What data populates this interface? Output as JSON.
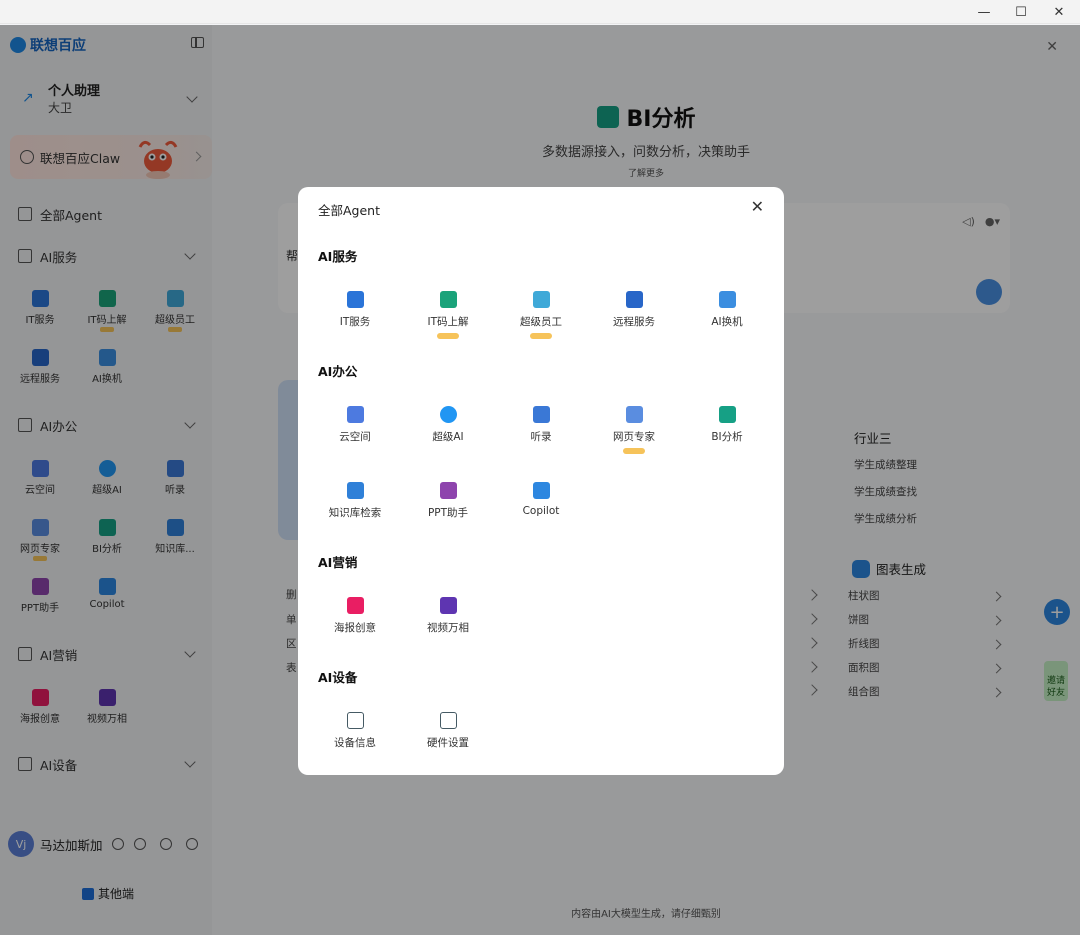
{
  "window": {
    "minimize": "—",
    "maximize": "☐",
    "close": "✕"
  },
  "sidebar": {
    "brand": "联想百应",
    "assistant": {
      "title": "个人助理",
      "subtitle": "大卫"
    },
    "claw": "联想百应Claw",
    "all_agent": "全部Agent",
    "ai_service": {
      "label": "AI服务",
      "items": [
        {
          "label": "IT服务",
          "color": "#2a74d8"
        },
        {
          "label": "IT码上解",
          "color": "#1aa37a"
        },
        {
          "label": "超级员工",
          "color": "#3fa9d8"
        },
        {
          "label": "远程服务",
          "color": "#2866c8"
        },
        {
          "label": "AI换机",
          "color": "#3b8ee0"
        }
      ]
    },
    "ai_office": {
      "label": "AI办公",
      "items": [
        {
          "label": "云空间",
          "color": "#4d7ae0"
        },
        {
          "label": "超级AI",
          "color": "#2196f3"
        },
        {
          "label": "听录",
          "color": "#3a78d6"
        },
        {
          "label": "网页专家",
          "color": "#5a8de0"
        },
        {
          "label": "BI分析",
          "color": "#16a085"
        },
        {
          "label": "知识库...",
          "color": "#2f80d8"
        },
        {
          "label": "PPT助手",
          "color": "#8e44ad"
        },
        {
          "label": "Copilot",
          "color": "#2d87e0"
        }
      ]
    },
    "ai_marketing": {
      "label": "AI营销",
      "items": [
        {
          "label": "海报创意",
          "color": "#e91e63"
        },
        {
          "label": "视频万相",
          "color": "#5e35b1"
        }
      ]
    },
    "ai_device": {
      "label": "AI设备"
    },
    "user": {
      "avatar": "Vj",
      "name": "马达加斯加"
    },
    "other_end": "其他端"
  },
  "main": {
    "title": "BI分析",
    "subtitle": "多数据源接入，问数分析，决策助手",
    "learn_more": "了解更多",
    "help_prefix": "帮",
    "industry3": {
      "title": "行业三",
      "items": [
        "学生成绩整理",
        "学生成绩查找",
        "学生成绩分析"
      ]
    },
    "chart_gen": {
      "title": "图表生成",
      "items": [
        "柱状图",
        "饼图",
        "折线图",
        "面积图",
        "组合图"
      ]
    },
    "left_list": [
      "删",
      "单",
      "区",
      "表"
    ],
    "invite": "邀请好友",
    "footer": "内容由AI大模型生成，请仔细甄别"
  },
  "modal": {
    "title": "全部Agent",
    "groups": [
      {
        "title": "AI服务",
        "items": [
          {
            "label": "IT服务",
            "color": "#2a74d8",
            "beta": false
          },
          {
            "label": "IT码上解",
            "color": "#1aa37a",
            "beta": true
          },
          {
            "label": "超级员工",
            "color": "#3fa9d8",
            "beta": true
          },
          {
            "label": "远程服务",
            "color": "#2866c8",
            "beta": false
          },
          {
            "label": "AI换机",
            "color": "#3b8ee0",
            "beta": false
          }
        ]
      },
      {
        "title": "AI办公",
        "items": [
          {
            "label": "云空间",
            "color": "#4d7ae0",
            "beta": false
          },
          {
            "label": "超级AI",
            "color": "#2196f3",
            "beta": false
          },
          {
            "label": "听录",
            "color": "#3a78d6",
            "beta": false
          },
          {
            "label": "网页专家",
            "color": "#5a8de0",
            "beta": true
          },
          {
            "label": "BI分析",
            "color": "#16a085",
            "beta": false
          },
          {
            "label": "知识库检索",
            "color": "#2f80d8",
            "beta": false
          },
          {
            "label": "PPT助手",
            "color": "#8e44ad",
            "beta": false
          },
          {
            "label": "Copilot",
            "color": "#2d87e0",
            "beta": false
          }
        ]
      },
      {
        "title": "AI营销",
        "items": [
          {
            "label": "海报创意",
            "color": "#e91e63",
            "beta": false
          },
          {
            "label": "视频万相",
            "color": "#5e35b1",
            "beta": false
          }
        ]
      },
      {
        "title": "AI设备",
        "items": [
          {
            "label": "设备信息",
            "color": "#455a64",
            "beta": false
          },
          {
            "label": "硬件设置",
            "color": "#455a64",
            "beta": false
          }
        ]
      }
    ]
  }
}
